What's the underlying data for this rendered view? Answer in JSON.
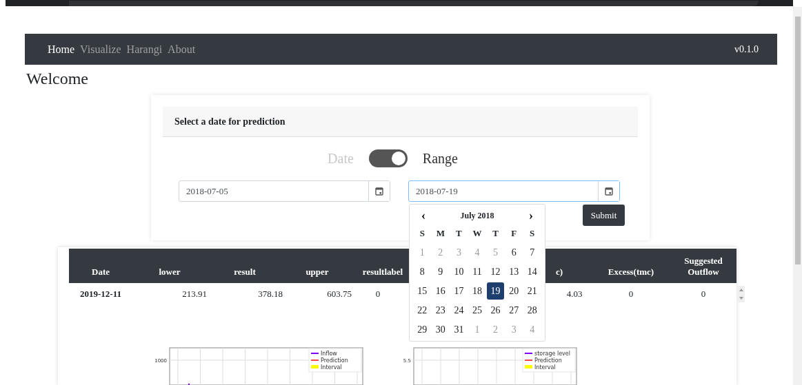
{
  "navbar": {
    "links": [
      {
        "label": "Home",
        "selected": true
      },
      {
        "label": "Visualize",
        "selected": false
      },
      {
        "label": "Harangi",
        "selected": false
      },
      {
        "label": "About",
        "selected": false
      }
    ],
    "version": "v0.1.0"
  },
  "heading": "Welcome",
  "form": {
    "title": "Select a date for prediction",
    "toggle": {
      "left_label": "Date",
      "right_label": "Range",
      "on": true
    },
    "start_date": {
      "value": "2018-07-05",
      "focused": false
    },
    "end_date": {
      "value": "2018-07-19",
      "focused": true
    },
    "submit": "Submit"
  },
  "calendar": {
    "month": "July 2018",
    "prev": "‹",
    "next": "›",
    "weekdays": [
      "S",
      "M",
      "T",
      "W",
      "T",
      "F",
      "S"
    ],
    "days": [
      {
        "label": "1",
        "outside": true,
        "selected": false
      },
      {
        "label": "2",
        "outside": true,
        "selected": false
      },
      {
        "label": "3",
        "outside": true,
        "selected": false
      },
      {
        "label": "4",
        "outside": true,
        "selected": false
      },
      {
        "label": "5",
        "outside": true,
        "selected": false
      },
      {
        "label": "6",
        "outside": false,
        "selected": false
      },
      {
        "label": "7",
        "outside": false,
        "selected": false
      },
      {
        "label": "8",
        "outside": false,
        "selected": false
      },
      {
        "label": "9",
        "outside": false,
        "selected": false
      },
      {
        "label": "10",
        "outside": false,
        "selected": false
      },
      {
        "label": "11",
        "outside": false,
        "selected": false
      },
      {
        "label": "12",
        "outside": false,
        "selected": false
      },
      {
        "label": "13",
        "outside": false,
        "selected": false
      },
      {
        "label": "14",
        "outside": false,
        "selected": false
      },
      {
        "label": "15",
        "outside": false,
        "selected": false
      },
      {
        "label": "16",
        "outside": false,
        "selected": false
      },
      {
        "label": "17",
        "outside": false,
        "selected": false
      },
      {
        "label": "18",
        "outside": false,
        "selected": false
      },
      {
        "label": "19",
        "outside": false,
        "selected": true
      },
      {
        "label": "20",
        "outside": false,
        "selected": false
      },
      {
        "label": "21",
        "outside": false,
        "selected": false
      },
      {
        "label": "22",
        "outside": false,
        "selected": false
      },
      {
        "label": "23",
        "outside": false,
        "selected": false
      },
      {
        "label": "24",
        "outside": false,
        "selected": false
      },
      {
        "label": "25",
        "outside": false,
        "selected": false
      },
      {
        "label": "26",
        "outside": false,
        "selected": false
      },
      {
        "label": "27",
        "outside": false,
        "selected": false
      },
      {
        "label": "28",
        "outside": false,
        "selected": false
      },
      {
        "label": "29",
        "outside": false,
        "selected": false
      },
      {
        "label": "30",
        "outside": false,
        "selected": false
      },
      {
        "label": "31",
        "outside": false,
        "selected": false
      },
      {
        "label": "1",
        "outside": true,
        "selected": false
      },
      {
        "label": "2",
        "outside": true,
        "selected": false
      },
      {
        "label": "3",
        "outside": true,
        "selected": false
      },
      {
        "label": "4",
        "outside": true,
        "selected": false
      }
    ]
  },
  "table": {
    "columns": [
      "Date",
      "lower",
      "result",
      "upper",
      "resultlabel",
      "c)",
      "Excess(tmc)",
      "Suggested Outflow"
    ],
    "rows": [
      {
        "cells": [
          "2019-12-11",
          "213.91",
          "378.18",
          "603.75",
          "0",
          "4.03",
          "0",
          "0"
        ]
      }
    ]
  },
  "charts": [
    {
      "ytick": "1000",
      "legend": [
        {
          "label": "Inflow",
          "color": "#7f00ff"
        },
        {
          "label": "Prediction",
          "color": "#ff4040"
        },
        {
          "label": "Interval",
          "color": "#ffff00"
        }
      ]
    },
    {
      "ytick": "5.5",
      "legend": [
        {
          "label": "storage level",
          "color": "#7f00ff"
        },
        {
          "label": "Prediction",
          "color": "#ff4040"
        },
        {
          "label": "Interval",
          "color": "#ffff00"
        }
      ]
    }
  ]
}
